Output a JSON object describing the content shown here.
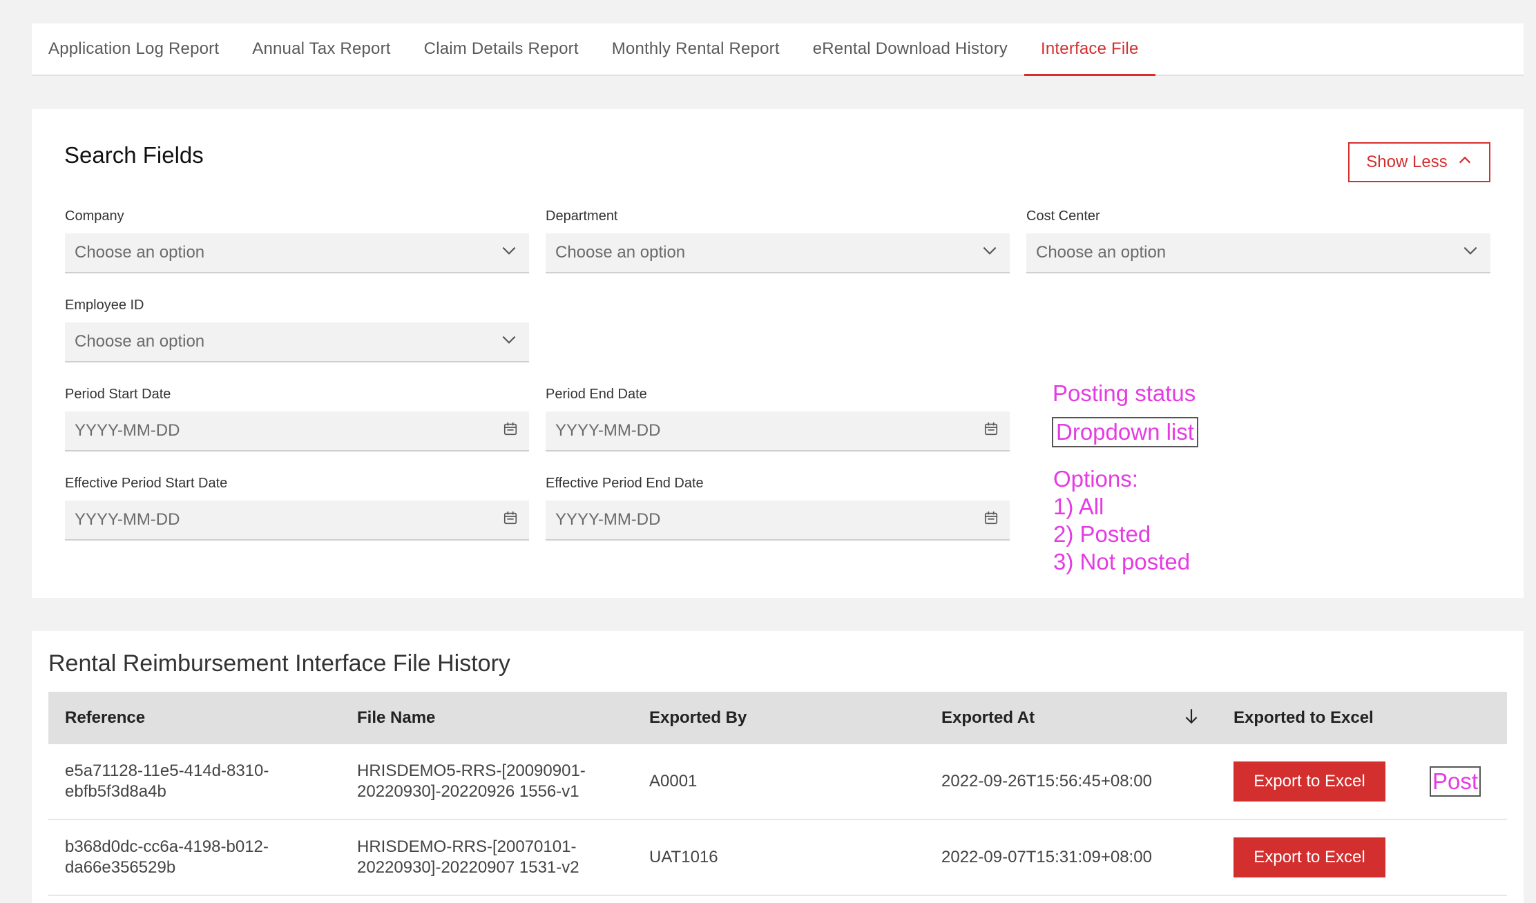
{
  "tabs": [
    {
      "label": "Application Log Report",
      "active": false
    },
    {
      "label": "Annual Tax Report",
      "active": false
    },
    {
      "label": "Claim Details Report",
      "active": false
    },
    {
      "label": "Monthly Rental Report",
      "active": false
    },
    {
      "label": "eRental Download History",
      "active": false
    },
    {
      "label": "Interface File",
      "active": true
    }
  ],
  "search": {
    "title": "Search Fields",
    "show_less_label": "Show Less",
    "fields": {
      "company": {
        "label": "Company",
        "placeholder": "Choose an option"
      },
      "department": {
        "label": "Department",
        "placeholder": "Choose an option"
      },
      "cost_center": {
        "label": "Cost Center",
        "placeholder": "Choose an option"
      },
      "employee_id": {
        "label": "Employee ID",
        "placeholder": "Choose an option"
      },
      "period_start": {
        "label": "Period Start Date",
        "placeholder": "YYYY-MM-DD"
      },
      "period_end": {
        "label": "Period End Date",
        "placeholder": "YYYY-MM-DD"
      },
      "eff_start": {
        "label": "Effective Period Start Date",
        "placeholder": "YYYY-MM-DD"
      },
      "eff_end": {
        "label": "Effective Period End Date",
        "placeholder": "YYYY-MM-DD"
      }
    }
  },
  "annotation": {
    "title": "Posting status",
    "box": "Dropdown list",
    "options_label": "Options:",
    "options": [
      "1) All",
      "2) Posted",
      "3) Not posted"
    ],
    "post": "Post",
    "color": "#e53be3"
  },
  "history": {
    "title": "Rental Reimbursement Interface File History",
    "columns": [
      "Reference",
      "File Name",
      "Exported By",
      "Exported At",
      "Exported to Excel"
    ],
    "rows": [
      {
        "reference_1": "e5a71128-11e5-414d-8310-",
        "reference_2": "ebfb5f3d8a4b",
        "file_1": "HRISDEMO5-RRS-[20090901-",
        "file_2": "20220930]-20220926 1556-v1",
        "exported_by": "A0001",
        "exported_at": "2022-09-26T15:56:45+08:00",
        "button": "Export to Excel"
      },
      {
        "reference_1": "b368d0dc-cc6a-4198-b012-",
        "reference_2": "da66e356529b",
        "file_1": "HRISDEMO-RRS-[20070101-",
        "file_2": "20220930]-20220907 1531-v2",
        "exported_by": "UAT1016",
        "exported_at": "2022-09-07T15:31:09+08:00",
        "button": "Export to Excel"
      }
    ]
  },
  "colors": {
    "accent": "#d32f2f",
    "background": "#f2f2f2"
  }
}
